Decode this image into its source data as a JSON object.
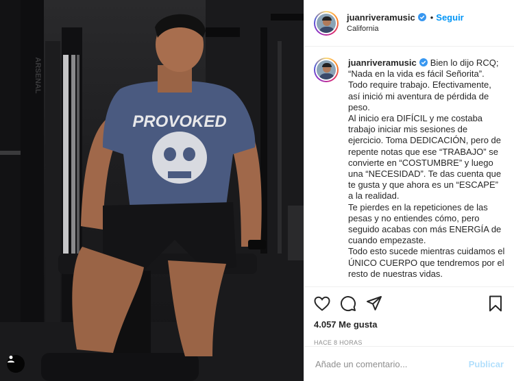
{
  "post": {
    "username": "juanriveramusic",
    "follow_label": "Seguir",
    "dot": "•",
    "location": "California",
    "caption_lines": [
      "Bien lo dijo RCQ; “Nada en la vida es fácil Señorita”. Todo require trabajo. Efectivamente, así inició mi aventura de pérdida de peso.",
      "Al inicio era DIFÍCIL y me costaba trabajo iniciar mis sesiones de ejercicio. Toma DEDICACIÓN, pero de repente notas que ese “TRABAJO” se convierte en “COSTUMBRE” y luego una “NECESIDAD”. Te das cuenta que te gusta y que ahora es un “ESCAPE” a la realidad.",
      "Te pierdes en la repeticiones de las pesas y no entiendes cómo, pero seguido acabas con más ENERGÍA de cuando empezaste.",
      "Todo esto sucede mientras cuidamos el ÚNICO CUERPO que tendremos por el resto de nuestras vidas."
    ],
    "likes": "4.057 Me gusta",
    "time": "HACE 8 HORAS",
    "shirt_text": "PROVOKED",
    "machine_text": "ARSENAL"
  },
  "comment": {
    "placeholder": "Añade un comentario...",
    "publish_label": "Publicar"
  },
  "icons": {
    "like": "heart-icon",
    "comment": "comment-icon",
    "share": "share-icon",
    "save": "bookmark-icon",
    "verified": "verified-badge-icon",
    "tag": "user-tag-icon"
  },
  "colors": {
    "accent": "#0095f6",
    "publish_disabled": "#b2dffc",
    "border": "#efefef",
    "muted": "#8e8e8e"
  }
}
